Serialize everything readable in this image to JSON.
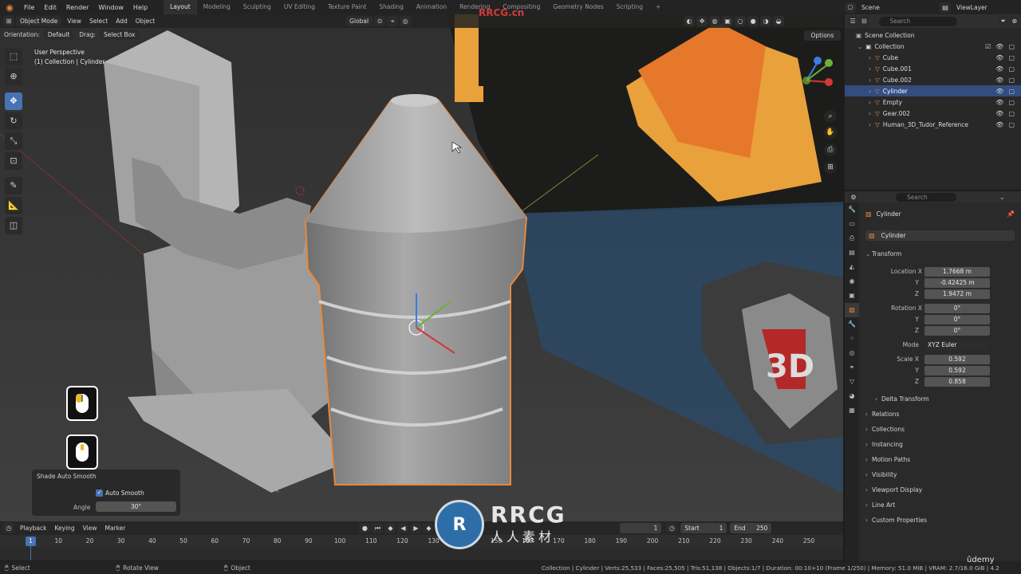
{
  "topbar": {
    "menus": [
      "File",
      "Edit",
      "Render",
      "Window",
      "Help"
    ],
    "workspaces": [
      "Layout",
      "Modeling",
      "Sculpting",
      "UV Editing",
      "Texture Paint",
      "Shading",
      "Animation",
      "Rendering",
      "Compositing",
      "Geometry Nodes",
      "Scripting"
    ],
    "active_workspace": "Layout",
    "scene": "Scene",
    "view_layer": "ViewLayer"
  },
  "viewport": {
    "mode": "Object Mode",
    "menus": [
      "View",
      "Select",
      "Add",
      "Object"
    ],
    "orientation_label": "Orientation:",
    "orientation_value": "Default",
    "drag_label": "Drag:",
    "drag_value": "Select Box",
    "transform_orientation": "Global",
    "options": "Options",
    "perspective": "User Perspective",
    "context": "(1) Collection | Cylinder"
  },
  "operator_panel": {
    "title": "Shade Auto Smooth",
    "checkbox_label": "Auto Smooth",
    "angle_label": "Angle",
    "angle_value": "30°"
  },
  "timeline": {
    "menus": [
      "Playback",
      "Keying",
      "View",
      "Marker"
    ],
    "current_frame": "1",
    "start_label": "Start",
    "start_value": "1",
    "end_label": "End",
    "end_value": "250",
    "ticks": [
      "10",
      "20",
      "30",
      "40",
      "50",
      "60",
      "70",
      "80",
      "90",
      "100",
      "110",
      "120",
      "130",
      "140",
      "150",
      "160",
      "170",
      "180",
      "190",
      "200",
      "210",
      "220",
      "230",
      "240",
      "250"
    ],
    "playhead": "1"
  },
  "outliner": {
    "search_placeholder": "Search",
    "scene_collection": "Scene Collection",
    "collection": "Collection",
    "objects": [
      "Cube",
      "Cube.001",
      "Cube.002",
      "Cylinder",
      "Empty",
      "Gear.002",
      "Human_3D_Tudor_Reference"
    ],
    "selected": "Cylinder"
  },
  "properties": {
    "search_placeholder": "Search",
    "object_name": "Cylinder",
    "data_name": "Cylinder",
    "transform_title": "Transform",
    "location_label": "Location X",
    "location": [
      "1.7668 m",
      "-0.42425 m",
      "1.9472 m"
    ],
    "rotation_label": "Rotation X",
    "rotation": [
      "0°",
      "0°",
      "0°"
    ],
    "mode_label": "Mode",
    "mode_value": "XYZ Euler",
    "scale_label": "Scale X",
    "scale": [
      "0.592",
      "0.592",
      "0.858"
    ],
    "axis_y": "Y",
    "axis_z": "Z",
    "delta": "Delta Transform",
    "sections": [
      "Relations",
      "Collections",
      "Instancing",
      "Motion Paths",
      "Visibility",
      "Viewport Display",
      "Line Art",
      "Custom Properties"
    ]
  },
  "statusbar": {
    "select": "Select",
    "rotate": "Rotate View",
    "object": "Object",
    "stats": "Collection | Cylinder | Verts:25,533 | Faces:25,505 | Tris:51,138 | Objects:1/7 | Duration: 00:10+10 (Frame 1/250) | Memory: 51.0 MiB | VRAM: 2.7/16.0 GiB | 4.2"
  },
  "watermark": {
    "top": "RRCG.cn",
    "title": "RRCG",
    "sub": "人人素材",
    "udemy": "ûdemy"
  },
  "colors": {
    "accent": "#4772b3",
    "selection_orange": "#e8883a"
  }
}
